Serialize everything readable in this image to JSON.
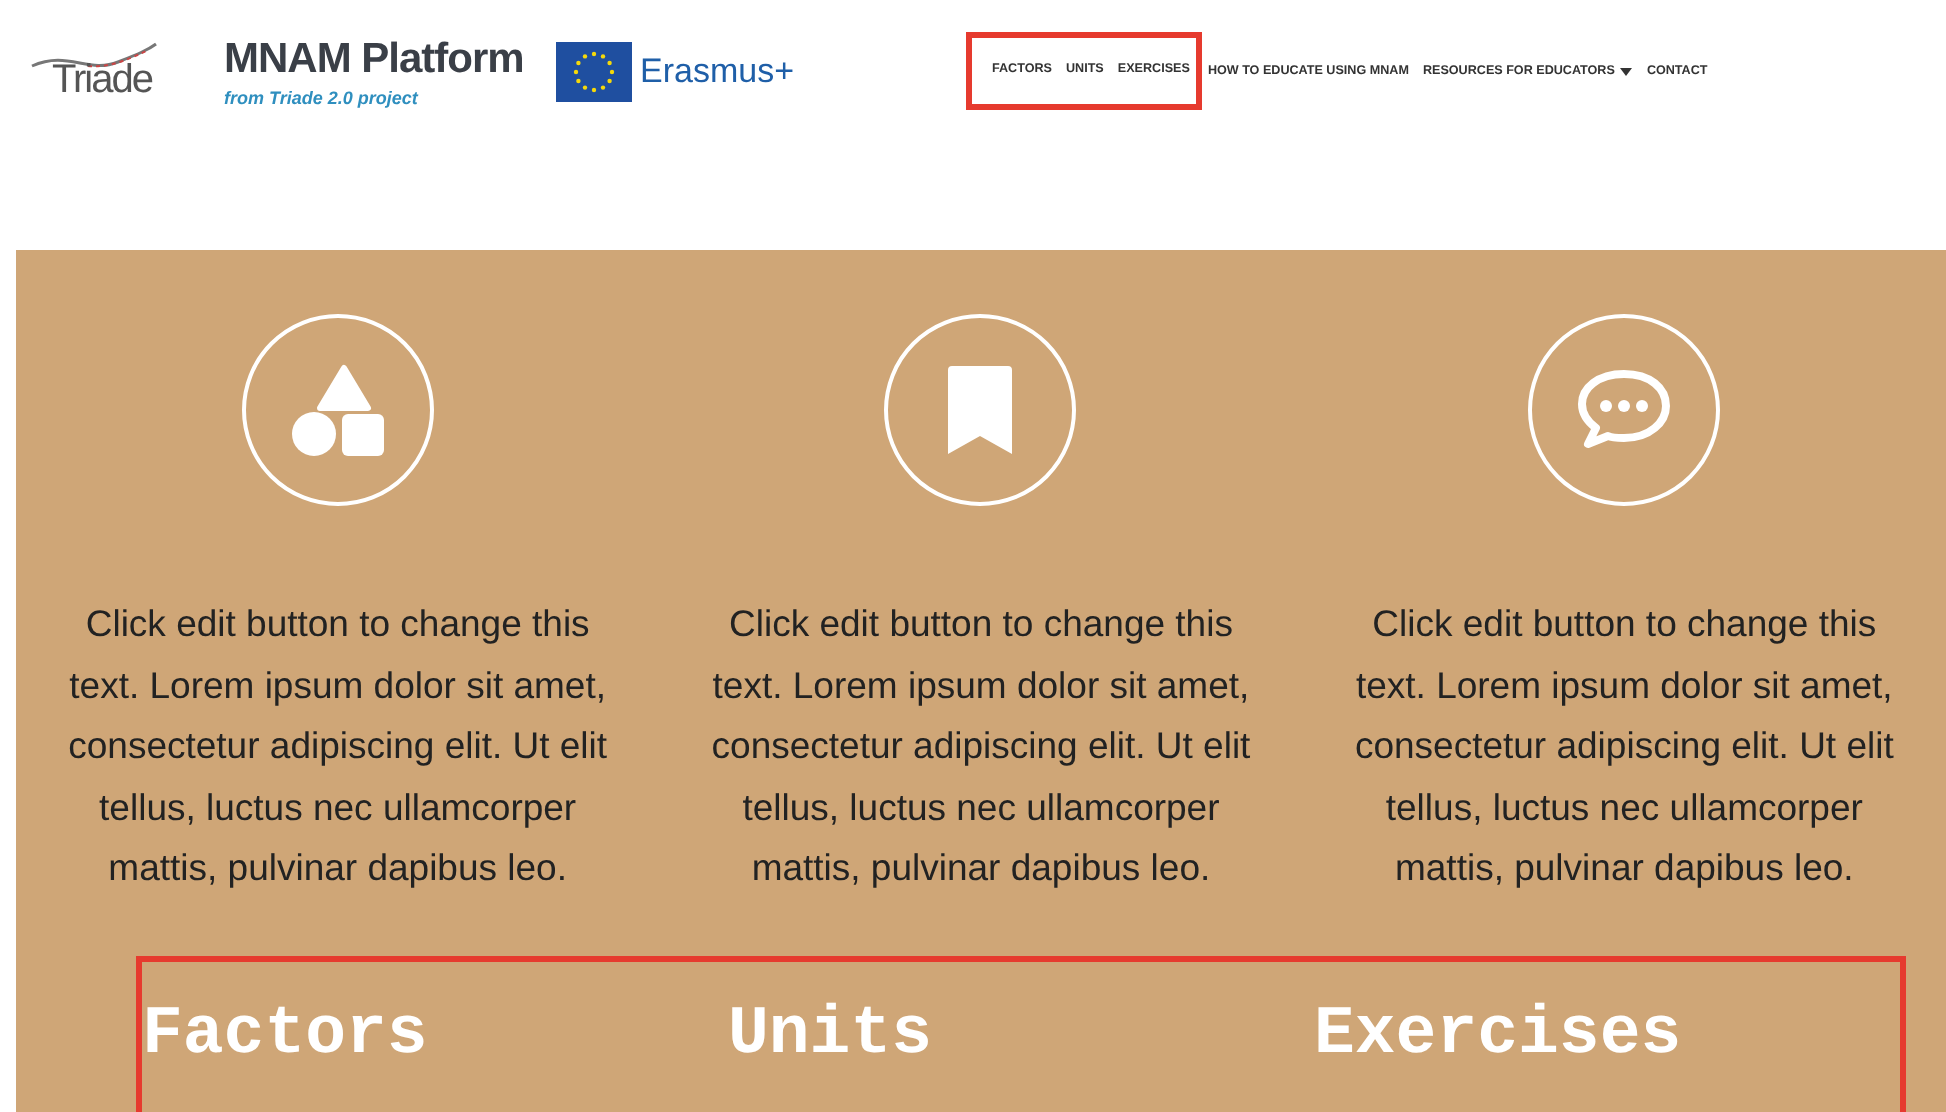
{
  "header": {
    "logos": [
      {
        "kind": "triade",
        "text": "Triade"
      },
      {
        "kind": "mnam",
        "text": "MNAM Platform",
        "subtitle": "from Triade 2.0 project"
      },
      {
        "kind": "erasmus",
        "text": "Erasmus+"
      }
    ],
    "nav": [
      {
        "label": "FACTORS",
        "highlighted": true,
        "dropdown": false
      },
      {
        "label": "UNITS",
        "highlighted": true,
        "dropdown": false
      },
      {
        "label": "EXERCISES",
        "highlighted": true,
        "dropdown": false
      },
      {
        "label": "HOW TO EDUCATE USING MNAM",
        "highlighted": false,
        "dropdown": false
      },
      {
        "label": "RESOURCES FOR EDUCATORS",
        "highlighted": false,
        "dropdown": true
      },
      {
        "label": "CONTACT",
        "highlighted": false,
        "dropdown": false
      }
    ]
  },
  "features": {
    "headings_highlighted": true,
    "columns": [
      {
        "kind": "shapes",
        "text": "Click edit button to change this text. Lorem ipsum dolor sit amet, consectetur adipiscing elit. Ut elit tellus, luctus nec ullamcorper mattis, pulvinar dapibus leo.",
        "heading": "Factors"
      },
      {
        "kind": "bookmark",
        "text": "Click edit button to change this text. Lorem ipsum dolor sit amet, consectetur adipiscing elit. Ut elit tellus, luctus nec ullamcorper mattis, pulvinar dapibus leo.",
        "heading": "Units"
      },
      {
        "kind": "chat",
        "text": "Click edit button to change this text. Lorem ipsum dolor sit amet, consectetur adipiscing elit. Ut elit tellus, luctus nec ullamcorper mattis, pulvinar dapibus leo.",
        "heading": "Exercises"
      }
    ]
  }
}
